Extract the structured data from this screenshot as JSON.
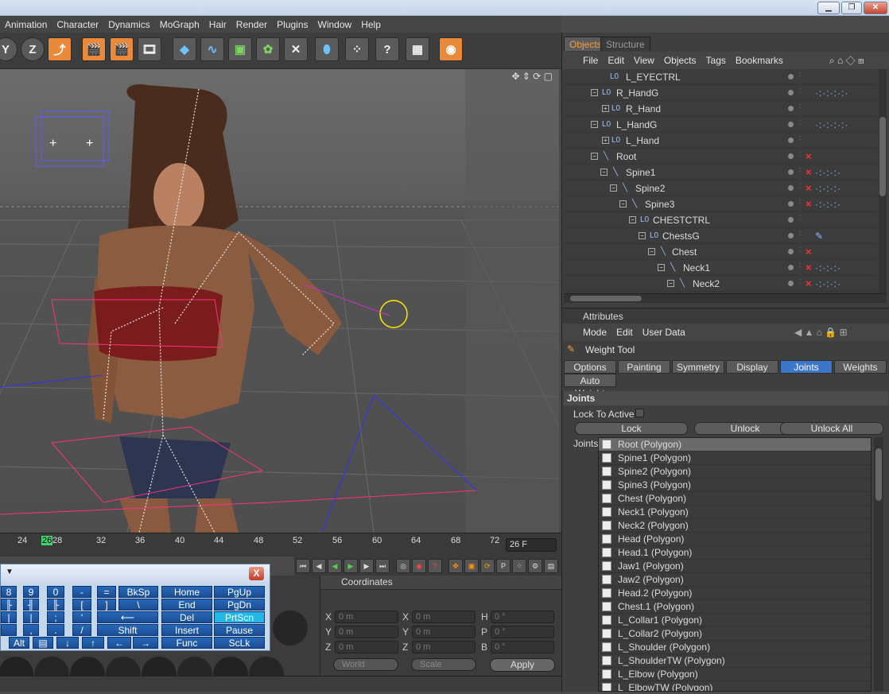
{
  "window": {
    "minimize": "▁",
    "restore": "❐",
    "close": "✕"
  },
  "menubar": {
    "items": [
      "Animation",
      "Character",
      "Dynamics",
      "MoGraph",
      "Hair",
      "Render",
      "Plugins",
      "Window",
      "Help"
    ]
  },
  "toolbar": {
    "axis_y": "Y",
    "axis_z": "Z"
  },
  "viewport": {
    "nav_icons": "✥ ⇕ ⟳ ▢"
  },
  "timeline": {
    "ticks": [
      "24",
      "26",
      "28",
      "32",
      "36",
      "40",
      "44",
      "48",
      "52",
      "56",
      "60",
      "64",
      "68",
      "72"
    ],
    "current_frame": "26 F"
  },
  "coords": {
    "title": "Coordinates",
    "rows": [
      {
        "l1": "X",
        "v1": "0 m",
        "l2": "X",
        "v2": "0 m",
        "l3": "H",
        "v3": "0 °"
      },
      {
        "l1": "Y",
        "v1": "0 m",
        "l2": "Y",
        "v2": "0 m",
        "l3": "P",
        "v3": "0 °"
      },
      {
        "l1": "Z",
        "v1": "0 m",
        "l2": "Z",
        "v2": "0 m",
        "l3": "B",
        "v3": "0 °"
      }
    ],
    "mode": "World",
    "mode2": "Scale",
    "apply": "Apply"
  },
  "osk": {
    "close": "X",
    "row1": [
      "8",
      "9",
      "0",
      "-",
      "=",
      "BkSp",
      "Home",
      "PgUp"
    ],
    "row2": [
      "]",
      "[",
      "]",
      "\\",
      "End",
      "PgDn"
    ],
    "row3": [
      ";",
      "'",
      "⟵",
      "Del",
      "PrtScn"
    ],
    "row4": [
      ",",
      ".",
      "/",
      "Shift",
      "Insert",
      "Pause"
    ],
    "row5": [
      "Alt",
      "↓",
      "↑",
      "←",
      "→",
      "Func",
      "ScLk"
    ]
  },
  "objects": {
    "tabs": [
      "Objects",
      "Structure"
    ],
    "menu": [
      "File",
      "Edit",
      "View",
      "Objects",
      "Tags",
      "Bookmarks"
    ],
    "rows": [
      {
        "name": "L_EYECTRL",
        "x": false,
        "tags": ""
      },
      {
        "name": "R_HandG",
        "x": false,
        "tags": "·:·:·:·:·"
      },
      {
        "name": "R_Hand",
        "x": false,
        "tags": ""
      },
      {
        "name": "L_HandG",
        "x": false,
        "tags": "·:·:·:·:·"
      },
      {
        "name": "L_Hand",
        "x": false,
        "tags": ""
      },
      {
        "name": "Root",
        "x": true,
        "tags": ""
      },
      {
        "name": "Spine1",
        "x": true,
        "tags": "·:·:·:·"
      },
      {
        "name": "Spine2",
        "x": true,
        "tags": "·:·:·:·"
      },
      {
        "name": "Spine3",
        "x": true,
        "tags": "·:·:·:·"
      },
      {
        "name": "CHESTCTRL",
        "x": false,
        "tags": ""
      },
      {
        "name": "ChestsG",
        "x": false,
        "tags": "✎"
      },
      {
        "name": "Chest",
        "x": true,
        "tags": ""
      },
      {
        "name": "Neck1",
        "x": true,
        "tags": "·:·:·:·"
      },
      {
        "name": "Neck2",
        "x": true,
        "tags": "·:·:·:·"
      }
    ]
  },
  "attributes": {
    "title": "Attributes",
    "menu": [
      "Mode",
      "Edit",
      "User Data"
    ],
    "tool": "Weight Tool",
    "tabs": [
      "Options",
      "Painting",
      "Symmetry",
      "Display",
      "Joints",
      "Weights"
    ],
    "tab_auto": "Auto Weight",
    "section": "Joints",
    "lock_to_active": "Lock To Active",
    "lock": "Lock",
    "unlock": "Unlock",
    "unlock_all": "Unlock All",
    "joints_label": "Joints",
    "joints": [
      "Root (Polygon)",
      "Spine1 (Polygon)",
      "Spine2 (Polygon)",
      "Spine3 (Polygon)",
      "Chest (Polygon)",
      "Neck1 (Polygon)",
      "Neck2 (Polygon)",
      "Head (Polygon)",
      "Head.1 (Polygon)",
      "Jaw1 (Polygon)",
      "Jaw2 (Polygon)",
      "Head.2 (Polygon)",
      "Chest.1 (Polygon)",
      "L_Collar1 (Polygon)",
      "L_Collar2 (Polygon)",
      "L_Shoulder (Polygon)",
      "L_ShoulderTW (Polygon)",
      "L_Elbow (Polygon)",
      "L_ElbowTW (Polygon)"
    ]
  }
}
